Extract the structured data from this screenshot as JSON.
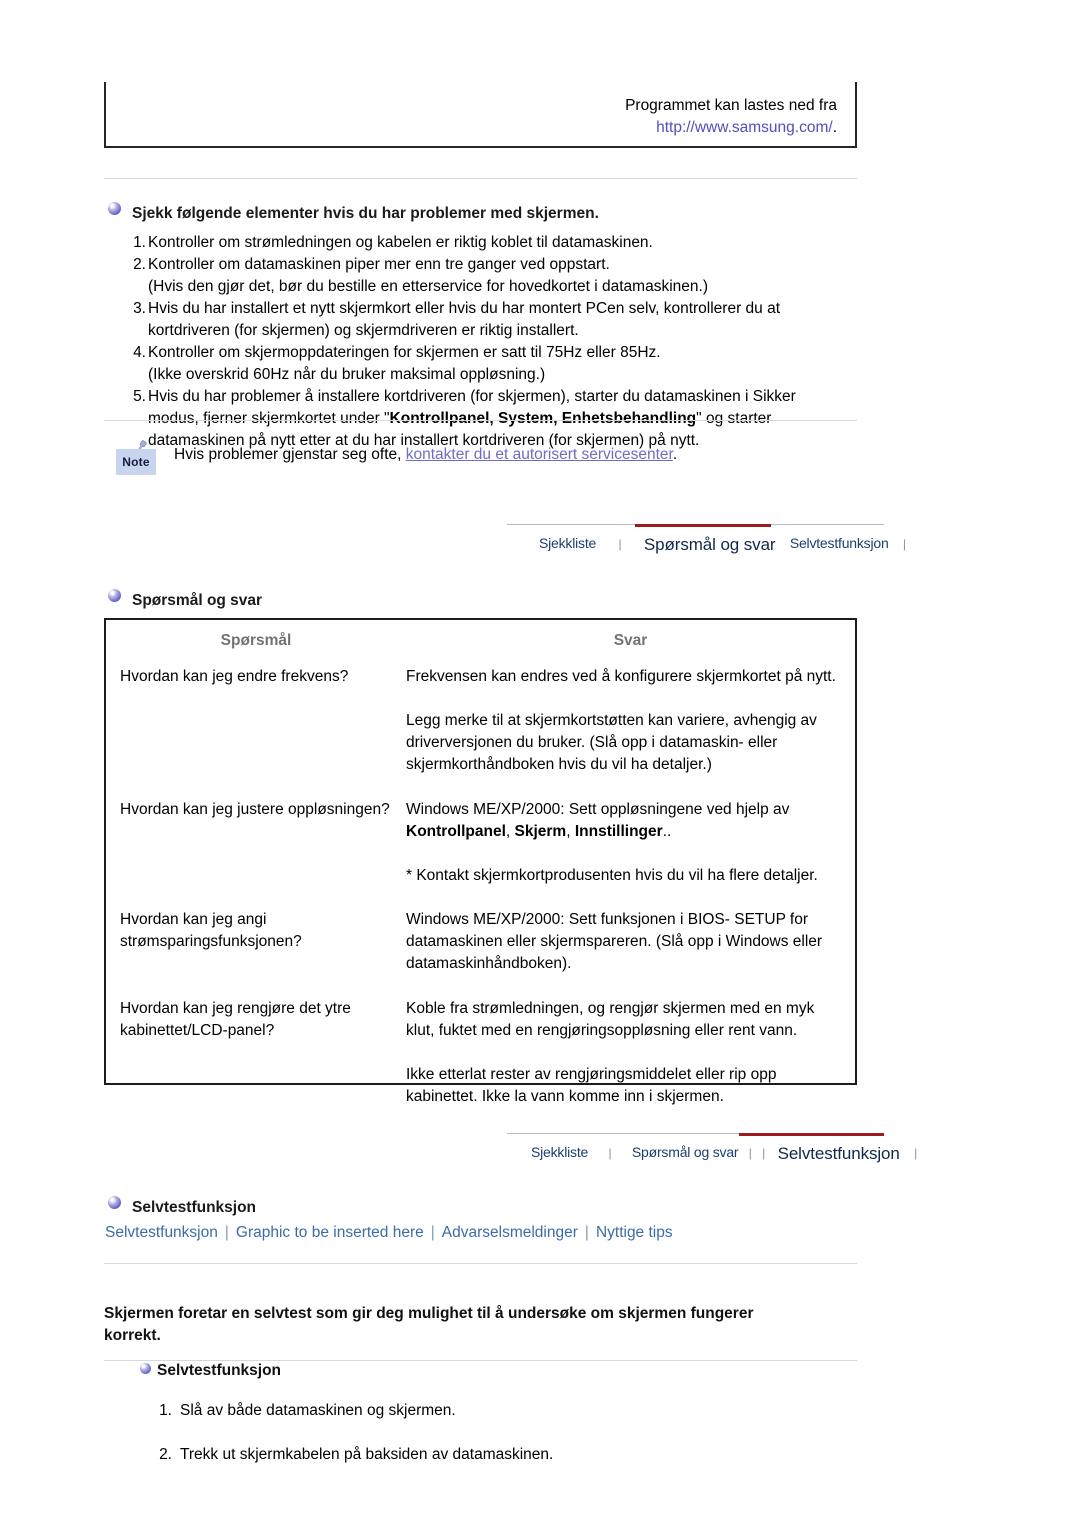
{
  "download_box": {
    "line1": "Programmet kan lastes ned fra",
    "link": "http://www.samsung.com/",
    "trailing": "."
  },
  "checklist": {
    "heading": "Sjekk følgende elementer hvis du har problemer med skjermen.",
    "items": [
      {
        "num": "1.",
        "text": "Kontroller om strømledningen og kabelen er riktig koblet til datamaskinen.",
        "sub": ""
      },
      {
        "num": "2.",
        "text": "Kontroller om datamaskinen piper mer enn tre ganger ved oppstart.",
        "sub": "(Hvis den gjør det, bør du bestille en etterservice for hovedkortet i datamaskinen.)"
      },
      {
        "num": "3.",
        "text": "Hvis du har installert et nytt skjermkort eller hvis du har montert PCen selv, kontrollerer du at",
        "sub": "kortdriveren (for skjermen) og skjermdriveren er riktig installert."
      },
      {
        "num": "4.",
        "text": "Kontroller om skjermoppdateringen for skjermen er satt til 75Hz eller 85Hz.",
        "sub": "(Ikke overskrid 60Hz når du bruker maksimal oppløsning.)"
      },
      {
        "num": "5.",
        "text_a": "Hvis du har problemer å installere kortdriveren (for skjermen), starter du datamaskinen i Sikker",
        "text_b_pre": "modus, fjerner skjermkortet under \"",
        "text_b_bold": "Kontrollpanel, System, Enhetsbehandling",
        "text_b_post": "\" og starter",
        "text_c": "datamaskinen på nytt etter at du har installert kortdriveren (for skjermen) på nytt."
      }
    ]
  },
  "note": {
    "badge_label": "Note",
    "text_pre": "Hvis problemer gjenstar seg ofte, ",
    "link": "kontakter du et autorisert servicesenter",
    "text_post": "."
  },
  "tabnav_1": {
    "tabs": [
      {
        "label": "Sjekkliste",
        "active": false
      },
      {
        "label": "Spørsmål og svar",
        "active": true
      },
      {
        "label": "Selvtestfunksjon",
        "active": false
      }
    ],
    "separator": "|",
    "active_color": "#9e1b20"
  },
  "qa_section": {
    "heading": "Spørsmål og svar",
    "col_headers": {
      "question": "Spørsmål",
      "answer": "Svar"
    },
    "rows": [
      {
        "question": "Hvordan kan jeg endre frekvens?",
        "answer_blocks": [
          {
            "text": "Frekvensen kan endres ved å konfigurere skjermkortet på nytt."
          },
          {
            "text": "Legg merke til at skjermkortstøtten kan variere, avhengig av driverversjonen du bruker. (Slå opp i datamaskin- eller skjermkorthåndboken hvis du vil ha detaljer.)"
          }
        ]
      },
      {
        "question": "Hvordan kan jeg justere oppløsningen?",
        "answer_blocks": [
          {
            "pre": "Windows ME/XP/2000: Sett oppløsningene ved hjelp av ",
            "bold_parts": [
              "Kontrollpanel",
              "Skjerm",
              "Innstillinger"
            ],
            "post": ".."
          },
          {
            "text": "* Kontakt skjermkortprodusenten hvis du vil ha flere detaljer."
          }
        ]
      },
      {
        "question": "Hvordan kan jeg angi strømsparingsfunksjonen?",
        "answer_blocks": [
          {
            "text": "Windows ME/XP/2000: Sett funksjonen i BIOS- SETUP for datamaskinen eller skjermspareren. (Slå opp i Windows eller datamaskinhåndboken)."
          }
        ]
      },
      {
        "question": "Hvordan kan jeg rengjøre det ytre kabinettet/LCD-panel?",
        "answer_blocks": [
          {
            "text": "Koble fra strømledningen, og rengjør skjermen med en myk klut, fuktet med en rengjøringsoppløsning eller rent vann."
          },
          {
            "text": "Ikke etterlat rester av rengjøringsmiddelet eller rip opp kabinettet. Ikke la vann komme inn i skjermen."
          }
        ]
      }
    ]
  },
  "tabnav_2": {
    "tabs": [
      {
        "label": "Sjekkliste",
        "active": false
      },
      {
        "label": "Spørsmål og svar",
        "active": false
      },
      {
        "label": "Selvtestfunksjon",
        "active": true
      }
    ],
    "separator": "|",
    "active_color": "#9e1b20"
  },
  "selftest_section": {
    "heading": "Selvtestfunksjon",
    "sublinks": [
      "Selvtestfunksjon",
      "Graphic to be inserted here",
      "Advarselsmeldinger",
      "Nyttige tips"
    ],
    "sublink_separator": "|",
    "intro_line1": "Skjermen foretar en selvtest som gir deg mulighet til å undersøke om skjermen fungerer",
    "intro_line2": "korrekt.",
    "sub_heading": "Selvtestfunksjon",
    "steps": [
      {
        "num": "1.",
        "text": "Slå av både datamaskinen og skjermen."
      },
      {
        "num": "2.",
        "text": "Trekk ut skjermkabelen på baksiden av datamaskinen."
      }
    ]
  }
}
